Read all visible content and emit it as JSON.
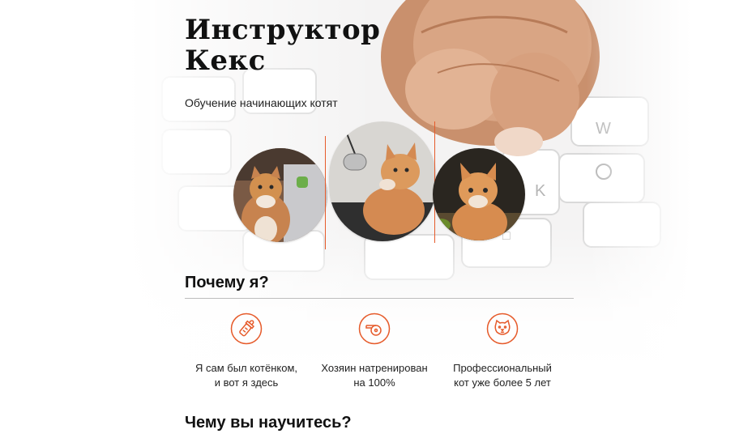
{
  "header": {
    "title": "Инструктор\nКекс",
    "subtitle": "Обучение начинающих котят"
  },
  "gallery": {
    "photos": [
      {
        "alt": "cat-with-laptop"
      },
      {
        "alt": "cat-with-microphone"
      },
      {
        "alt": "cat-portrait"
      }
    ]
  },
  "why": {
    "heading": "Почему я?",
    "features": [
      {
        "icon": "baby-bottle-icon",
        "text": "Я сам был котёнком,\nи вот я здесь"
      },
      {
        "icon": "whistle-icon",
        "text": "Хозяин натренирован\nна 100%"
      },
      {
        "icon": "cat-face-icon",
        "text": "Профессиональный\nкот уже более 5 лет"
      }
    ]
  },
  "learn": {
    "heading": "Чему вы научитесь?"
  },
  "colors": {
    "accent": "#e65b2b",
    "text": "#111111",
    "rule": "#bdbdbd"
  }
}
